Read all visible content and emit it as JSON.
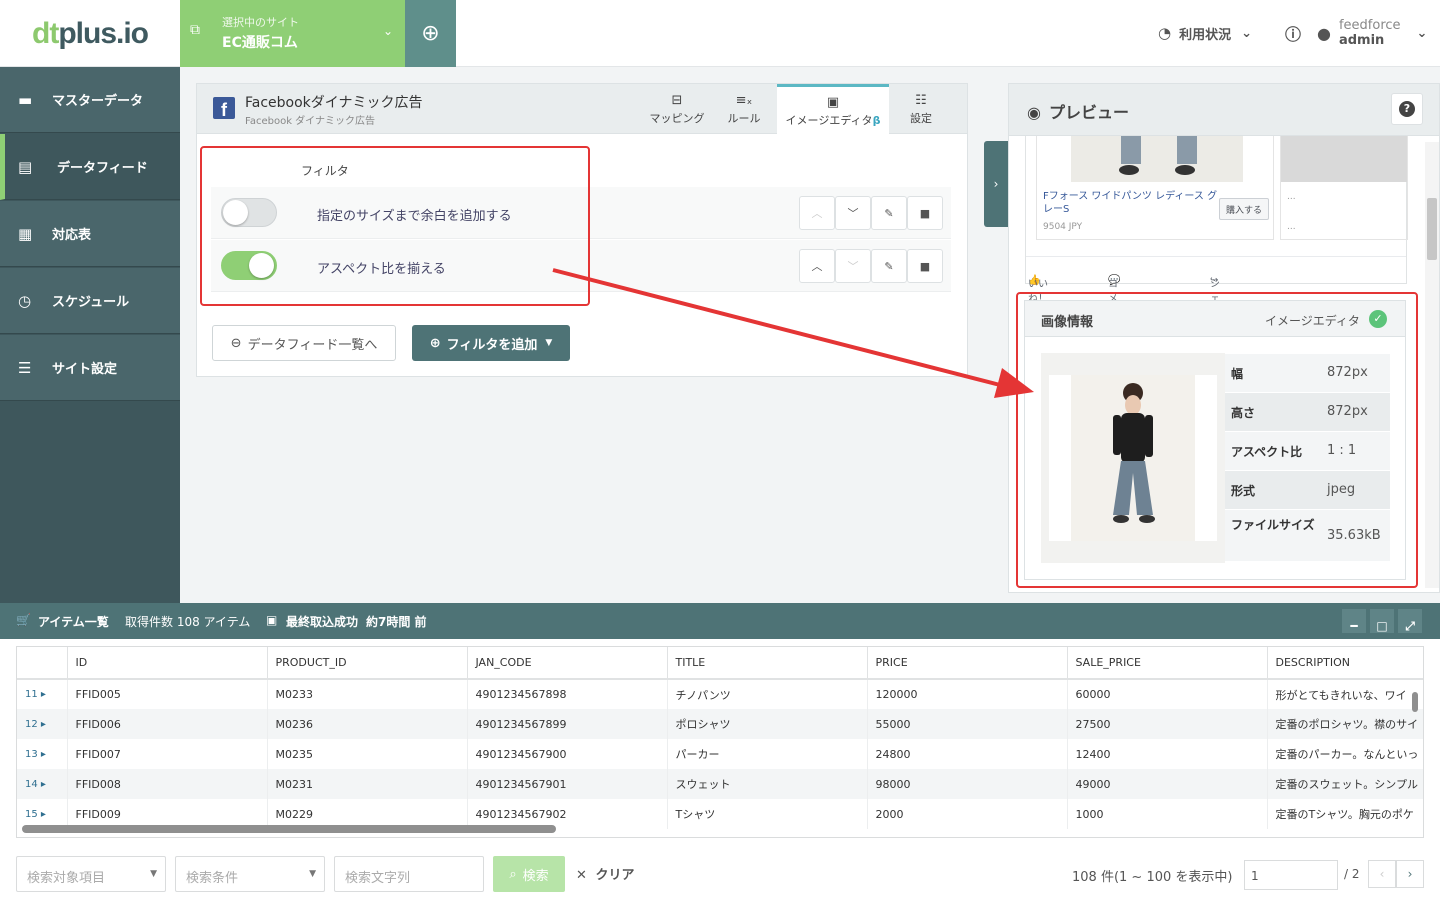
{
  "header": {
    "logo": "dtplus.io",
    "site_sub": "選択中のサイト",
    "site_name": "EC通販コム",
    "usage_label": "利用状況",
    "org": "feedforce",
    "user": "admin"
  },
  "sidebar": {
    "items": [
      {
        "label": "マスターデータ",
        "icon": "folder-icon"
      },
      {
        "label": "データフィード",
        "icon": "file-icon"
      },
      {
        "label": "対応表",
        "icon": "grid-icon"
      },
      {
        "label": "スケジュール",
        "icon": "calendar-clock-icon"
      },
      {
        "label": "サイト設定",
        "icon": "sliders-icon"
      }
    ]
  },
  "panel": {
    "title": "Facebookダイナミック広告",
    "subtitle": "Facebook ダイナミック広告",
    "tabs": [
      {
        "label": "マッピング",
        "icon": "mapping-icon"
      },
      {
        "label": "ルール",
        "icon": "function-icon"
      },
      {
        "label": "イメージエディタ",
        "beta": "β",
        "icon": "image-file-icon"
      },
      {
        "label": "設定",
        "icon": "sliders-icon"
      }
    ],
    "filter_heading": "フィルタ",
    "filters": [
      {
        "label": "指定のサイズまで余白を追加する",
        "enabled": false
      },
      {
        "label": "アスペクト比を揃える",
        "enabled": true
      }
    ],
    "back_button": "データフィード一覧へ",
    "add_filter_button": "フィルタを追加"
  },
  "preview": {
    "title": "プレビュー",
    "card_title": "Fフォース ワイドパンツ レディース グレーS",
    "card_price": "9504 JPY",
    "buy_button": "購入する",
    "ellipsis": "...",
    "actions": [
      "いいね！",
      "コメントする",
      "シェアする"
    ],
    "image_info": {
      "title": "画像情報",
      "editor_label": "イメージエディタ",
      "rows": [
        {
          "key": "幅",
          "value": "872px"
        },
        {
          "key": "高さ",
          "value": "872px"
        },
        {
          "key": "アスペクト比",
          "value": "1 : 1"
        },
        {
          "key": "形式",
          "value": "jpeg"
        },
        {
          "key": "ファイルサイズ",
          "value": "35.63kB"
        }
      ]
    }
  },
  "items_bar": {
    "label": "アイテム一覧",
    "count": "取得件数 108 アイテム",
    "last_import": "最終取込成功",
    "last_import_time": "約7時間 前"
  },
  "table": {
    "columns": [
      "ID",
      "PRODUCT_ID",
      "JAN_CODE",
      "TITLE",
      "PRICE",
      "SALE_PRICE",
      "DESCRIPTION"
    ],
    "rows": [
      {
        "n": "11",
        "cells": [
          "FFID005",
          "M0233",
          "4901234567898",
          "チノパンツ",
          "120000",
          "60000",
          "形がとてもきれいな、ワイ"
        ]
      },
      {
        "n": "12",
        "cells": [
          "FFID006",
          "M0236",
          "4901234567899",
          "ポロシャツ",
          "55000",
          "27500",
          "定番のポロシャツ。襟のサイ"
        ]
      },
      {
        "n": "13",
        "cells": [
          "FFID007",
          "M0235",
          "4901234567900",
          "パーカー",
          "24800",
          "12400",
          "定番のパーカー。なんといっ"
        ]
      },
      {
        "n": "14",
        "cells": [
          "FFID008",
          "M0231",
          "4901234567901",
          "スウェット",
          "98000",
          "49000",
          "定番のスウェット。シンプル"
        ]
      },
      {
        "n": "15",
        "cells": [
          "FFID009",
          "M0229",
          "4901234567902",
          "Tシャツ",
          "2000",
          "1000",
          "定番のTシャツ。胸元のポケ"
        ]
      }
    ]
  },
  "search": {
    "target_placeholder": "検索対象項目",
    "condition_placeholder": "検索条件",
    "text_placeholder": "検索文字列",
    "search_button": "検索",
    "clear_button": "クリア",
    "count_text": "108 件(1 ~ 100 を表示中)",
    "page_value": "1",
    "page_total": "/ 2"
  },
  "colors": {
    "accent_green": "#8fcf75",
    "teal": "#4e7376",
    "sidebar": "#3e575c",
    "highlight_red": "#e43535"
  }
}
